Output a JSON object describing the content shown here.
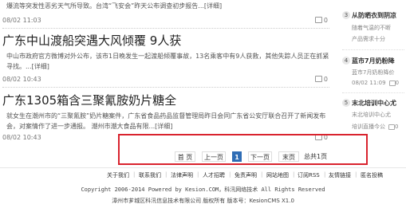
{
  "articles": [
    {
      "snippet": "爆流等突发性恶劣天气所导致。台湾“飞安会”昨天公布调查初步报告...[详细]",
      "date": "08/02 11:03",
      "comments": "0"
    },
    {
      "title": "广东中山渡船突遇大风倾覆 9人获",
      "summary": "中山市政府官方微博对外公布，该市1日晚发生一起渡船倾覆事故，13名乘客中有9人获救，其他失踪人员正在抓紧寻找。...[详细]",
      "date": "08/02 10:43",
      "comments": "0"
    },
    {
      "title": "广东1305箱含三聚氰胺奶片糖全",
      "summary": "就女生在潮州市的“三聚氰胺”奶片糖案件，广东省食品药品监督管理局昨日会同广东省公安厅联合召开了新闻发布会，对案情作了进一步通报。 潮州市潮大食品有限...[详细]",
      "date": "08/02 10:43",
      "comments": "0"
    }
  ],
  "sidebar": {
    "items": [
      {
        "num": "3",
        "title": "从防晒衣到阴凉",
        "sub": "随着气温的不断",
        "foot": "产品需求十分"
      },
      {
        "num": "4",
        "title": "蓝市7月奶粉降",
        "sub": "蓝市7月奶粉降价",
        "foot": "08/02 11:09",
        "comments": "0"
      },
      {
        "num": "5",
        "title": "末北培训中心尤",
        "sub": "末北培训中心尤",
        "foot": "培训直播今公",
        "comments": "0"
      }
    ]
  },
  "pagination": {
    "first": "首 页",
    "prev": "上一页",
    "current": "1",
    "next": "下一页",
    "last": "末页",
    "total": "总共1页"
  },
  "footer": {
    "links": [
      "关于我们",
      "联系我们",
      "法律声明",
      "人才招聘",
      "免责声明",
      "网站地图",
      "订阅RSS",
      "友情链接",
      "匿名投稿"
    ],
    "copyright": "Copyright 2006-2014 Powered by Kesion.COM，科汛网络技术 All Rights Reserved",
    "icp": "漳州市芗城区科汛信息技术有限公司 版权所有 版本号：KesionCMS X1.0"
  }
}
